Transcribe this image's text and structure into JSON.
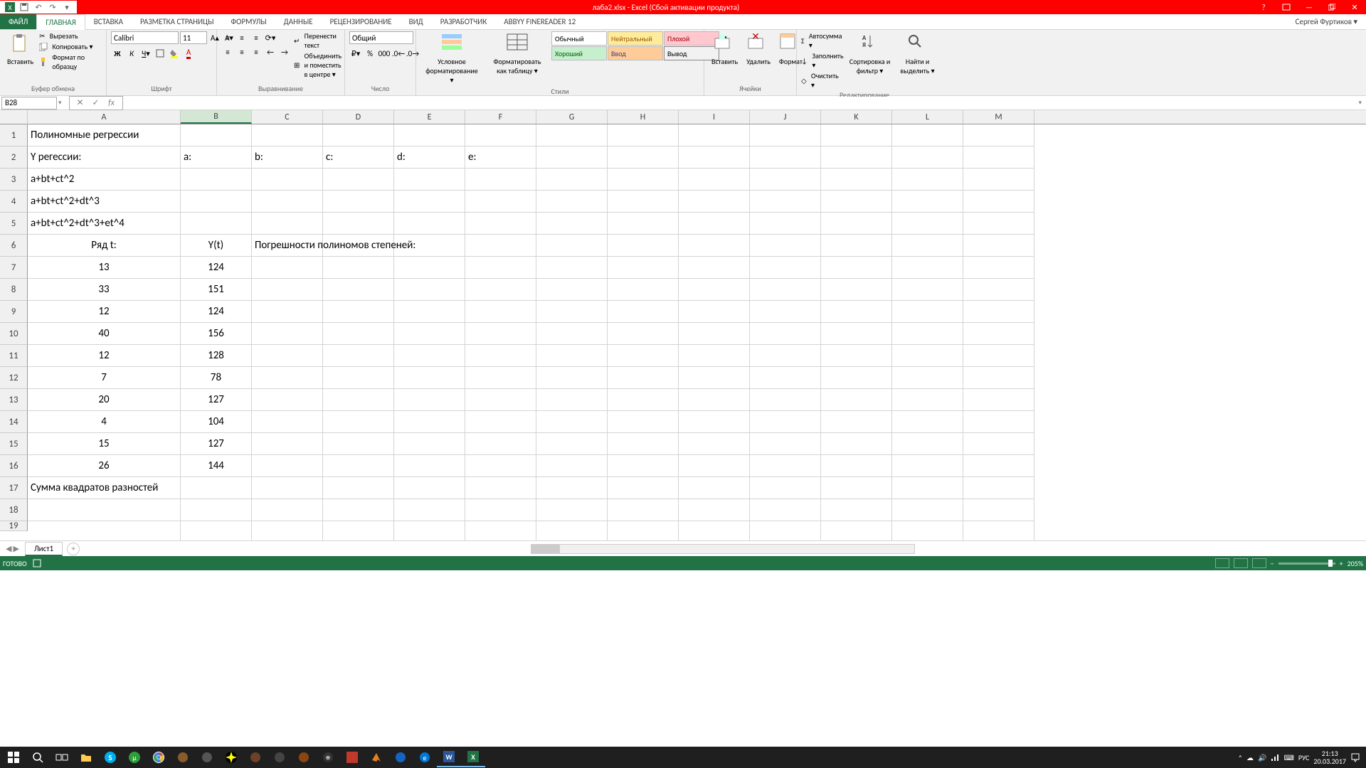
{
  "title_bar": {
    "filename_app": "лаба2.xlsx - Excel (Сбой активации продукта)"
  },
  "tabs": {
    "file": "ФАЙЛ",
    "list": [
      "ГЛАВНАЯ",
      "ВСТАВКА",
      "РАЗМЕТКА СТРАНИЦЫ",
      "ФОРМУЛЫ",
      "ДАННЫЕ",
      "РЕЦЕНЗИРОВАНИЕ",
      "ВИД",
      "РАЗРАБОТЧИК",
      "ABBYY FineReader 12"
    ],
    "active": 0,
    "user": "Сергей Фуртиков ▾"
  },
  "ribbon": {
    "clipboard": {
      "paste": "Вставить",
      "cut": "Вырезать",
      "copy": "Копировать ▾",
      "format_painter": "Формат по образцу",
      "label": "Буфер обмена"
    },
    "font": {
      "name": "Calibri",
      "size": "11",
      "label": "Шрифт"
    },
    "align": {
      "wrap": "Перенести текст",
      "merge": "Объединить и поместить в центре ▾",
      "label": "Выравнивание"
    },
    "number": {
      "format": "Общий",
      "label": "Число"
    },
    "styles": {
      "cond": "Условное форматирование ▾",
      "table": "Форматировать как таблицу ▾",
      "s1": "Обычный",
      "s2": "Нейтральный",
      "s3": "Плохой",
      "s4": "Хороший",
      "s5": "Ввод",
      "s6": "Вывод",
      "label": "Стили"
    },
    "cells": {
      "insert": "Вставить",
      "delete": "Удалить",
      "format": "Формат",
      "label": "Ячейки"
    },
    "editing": {
      "autosum": "Автосумма ▾",
      "fill": "Заполнить ▾",
      "clear": "Очистить ▾",
      "sort": "Сортировка и фильтр ▾",
      "find": "Найти и выделить ▾",
      "label": "Редактирование"
    }
  },
  "namebox": "B28",
  "formula_bar": "",
  "columns": [
    "A",
    "B",
    "C",
    "D",
    "E",
    "F",
    "G",
    "H",
    "I",
    "J",
    "K",
    "L",
    "M"
  ],
  "rows_shown": 18,
  "cells": {
    "r1": {
      "A": "Полиномные регрессии"
    },
    "r2": {
      "A": "Y регессии:",
      "B": "a:",
      "C": "b:",
      "D": "c:",
      "E": "d:",
      "F": "e:"
    },
    "r3": {
      "A": "a+bt+ct^2"
    },
    "r4": {
      "A": "a+bt+ct^2+dt^3"
    },
    "r5": {
      "A": "a+bt+ct^2+dt^3+et^4"
    },
    "r6": {
      "A": "Ряд t:",
      "B": "Y(t)",
      "C": "Погрешности полиномов степеней:"
    },
    "r7": {
      "A": "13",
      "B": "124"
    },
    "r8": {
      "A": "33",
      "B": "151"
    },
    "r9": {
      "A": "12",
      "B": "124"
    },
    "r10": {
      "A": "40",
      "B": "156"
    },
    "r11": {
      "A": "12",
      "B": "128"
    },
    "r12": {
      "A": "7",
      "B": "78"
    },
    "r13": {
      "A": "20",
      "B": "127"
    },
    "r14": {
      "A": "4",
      "B": "104"
    },
    "r15": {
      "A": "15",
      "B": "127"
    },
    "r16": {
      "A": "26",
      "B": "144"
    },
    "r17": {
      "A": "Сумма квадратов разностей"
    }
  },
  "sheet_tabs": {
    "active": "Лист1"
  },
  "status": {
    "ready": "ГОТОВО",
    "zoom": "205%"
  },
  "taskbar": {
    "lang": "РУС",
    "time": "21:13",
    "date": "20.03.2017"
  }
}
